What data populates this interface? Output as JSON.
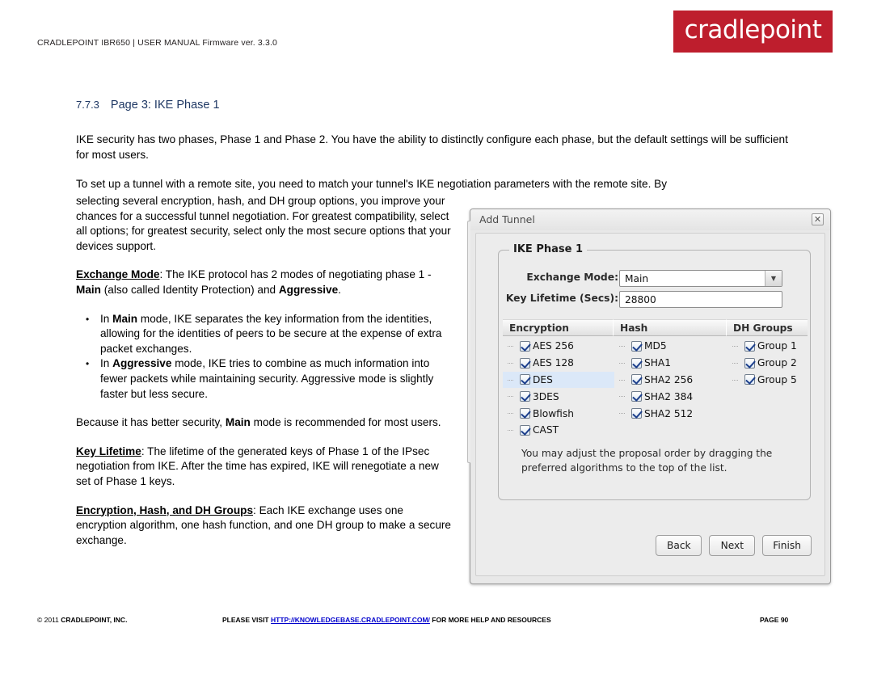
{
  "header": {
    "manual_line": "CRADLEPOINT IBR650 | USER MANUAL Firmware ver. 3.3.0",
    "logo_text": "cradlepoint",
    "logo_color": "#be1e2d"
  },
  "section": {
    "number": "7.7.3",
    "title": "Page 3: IKE Phase 1",
    "title_color": "#1f3864"
  },
  "body": {
    "p1": "IKE security has two phases, Phase 1 and Phase 2. You have the ability to distinctly configure each phase, but the default settings will be sufficient for most users.",
    "p2": "To set up a tunnel with a remote site, you need to match your tunnel's IKE negotiation parameters with the remote site. By",
    "p3": "selecting several encryption, hash, and DH group options, you improve your chances for a successful tunnel negotiation. For greatest compatibility, select all options; for greatest security, select only the most secure options that your devices support.",
    "exchange_mode_term": "Exchange Mode",
    "exchange_mode_text_a": ": The IKE protocol has 2 modes of negotiating phase 1 - ",
    "exchange_mode_main": "Main",
    "exchange_mode_text_b": " (also called Identity Protection) and ",
    "exchange_mode_aggressive": "Aggressive",
    "exchange_mode_text_c": ".",
    "bullet1_a": "In ",
    "bullet1_b": "Main",
    "bullet1_c": " mode, IKE separates the key information from the identities, allowing for the identities of peers to be secure at the expense of extra packet exchanges.",
    "bullet2_a": "In ",
    "bullet2_b": "Aggressive",
    "bullet2_c": " mode, IKE tries to combine as much information into fewer packets while maintaining security. Aggressive mode is slightly faster but less secure.",
    "p4_a": "Because it has better security, ",
    "p4_b": "Main",
    "p4_c": " mode is recommended for most users.",
    "key_lifetime_term": "Key Lifetime",
    "key_lifetime_text": ": The lifetime of the generated keys of Phase 1 of the IPsec negotiation from IKE. After the time has expired, IKE will renegotiate a new set of Phase 1 keys.",
    "encryption_term": "Encryption, Hash, and DH Groups",
    "encryption_text": ": Each IKE exchange uses one encryption algorithm, one hash function, and one DH group to make a secure exchange."
  },
  "dialog": {
    "title": "Add Tunnel",
    "close_icon": "close-icon",
    "close_glyph": "✕",
    "fieldset_legend": "IKE Phase 1",
    "fields": [
      {
        "label": "Exchange Mode:",
        "value": "Main",
        "type": "select",
        "arrow_glyph": "▼"
      },
      {
        "label": "Key Lifetime (Secs):",
        "value": "28800",
        "type": "text"
      }
    ],
    "table": {
      "headers": [
        "Encryption",
        "Hash",
        "DH Groups"
      ],
      "columns": [
        [
          {
            "label": "AES 256",
            "checked": true,
            "selected": false
          },
          {
            "label": "AES 128",
            "checked": true,
            "selected": false
          },
          {
            "label": "DES",
            "checked": true,
            "selected": true
          },
          {
            "label": "3DES",
            "checked": true,
            "selected": false
          },
          {
            "label": "Blowfish",
            "checked": true,
            "selected": false
          },
          {
            "label": "CAST",
            "checked": true,
            "selected": false
          }
        ],
        [
          {
            "label": "MD5",
            "checked": true,
            "selected": false
          },
          {
            "label": "SHA1",
            "checked": true,
            "selected": false
          },
          {
            "label": "SHA2 256",
            "checked": true,
            "selected": false
          },
          {
            "label": "SHA2 384",
            "checked": true,
            "selected": false
          },
          {
            "label": "SHA2 512",
            "checked": true,
            "selected": false
          }
        ],
        [
          {
            "label": "Group 1",
            "checked": true,
            "selected": false
          },
          {
            "label": "Group 2",
            "checked": true,
            "selected": false
          },
          {
            "label": "Group 5",
            "checked": true,
            "selected": false
          }
        ]
      ],
      "selected_row_color": "#dbe8f8"
    },
    "hint": "You may adjust the proposal order by dragging the preferred algorithms to the top of the list.",
    "buttons": [
      "Back",
      "Next",
      "Finish"
    ]
  },
  "footer": {
    "copyright_symbol": "© 2011 ",
    "copyright": "CRADLEPOINT, INC.",
    "visit_prefix": "PLEASE VISIT ",
    "link": "HTTP://KNOWLEDGEBASE.CRADLEPOINT.COM/",
    "visit_suffix": " FOR MORE HELP AND RESOURCES",
    "page": "PAGE 90",
    "link_color": "#0000cc"
  }
}
